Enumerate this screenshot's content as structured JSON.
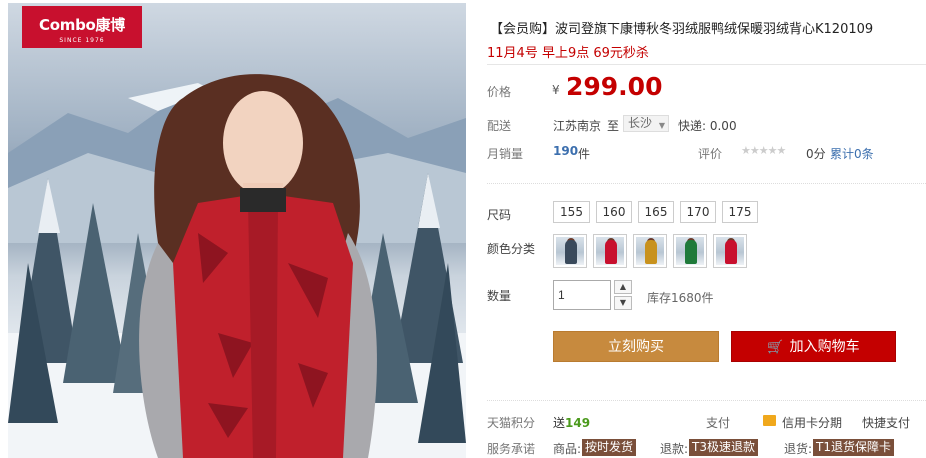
{
  "product": {
    "title": "【会员购】波司登旗下康博秋冬羽绒服鸭绒保暖羽绒背心K120109",
    "promo": "11月4号 早上9点 69元秒杀"
  },
  "brand": {
    "logo_text": "Combo康博",
    "since": "SINCE 1976"
  },
  "price": {
    "label": "价格",
    "currency": "¥",
    "value": "299.00"
  },
  "shipping": {
    "label": "配送",
    "from": "江苏南京",
    "to_word": "至",
    "city": "长沙",
    "express": "快递: 0.00"
  },
  "sales": {
    "label": "月销量",
    "count": "190",
    "unit": "件",
    "rating_label": "评价",
    "stars": "★★★★★",
    "score": "0分",
    "reviews": "累计0条"
  },
  "size": {
    "label": "尺码",
    "options": [
      "155",
      "160",
      "165",
      "170",
      "175"
    ]
  },
  "color": {
    "label": "颜色分类",
    "swatches": [
      "#3a4a5c",
      "#c8102e",
      "#c8921e",
      "#1f7a3a",
      "#c8102e"
    ]
  },
  "quantity": {
    "label": "数量",
    "value": "1",
    "stock": "库存1680件"
  },
  "actions": {
    "buy_now": "立刻购买",
    "add_cart": "加入购物车"
  },
  "tmall_points": {
    "label": "天猫积分",
    "value_prefix": "送",
    "value": "149"
  },
  "payment": {
    "label": "支付",
    "installment": "信用卡分期",
    "quick_pay": "快捷支付"
  },
  "service": {
    "label": "服务承诺",
    "items": [
      {
        "prefix": "商品:",
        "tag": "按时发货"
      },
      {
        "prefix": "退款:",
        "tag": "T3极速退款"
      },
      {
        "prefix": "退货:",
        "tag": "T1退货保障卡"
      }
    ]
  },
  "colors": {
    "price_red": "#c40000",
    "buy_now_bg": "#c78a3e",
    "add_cart_bg": "#c40000",
    "logo_red": "#c8102e"
  }
}
